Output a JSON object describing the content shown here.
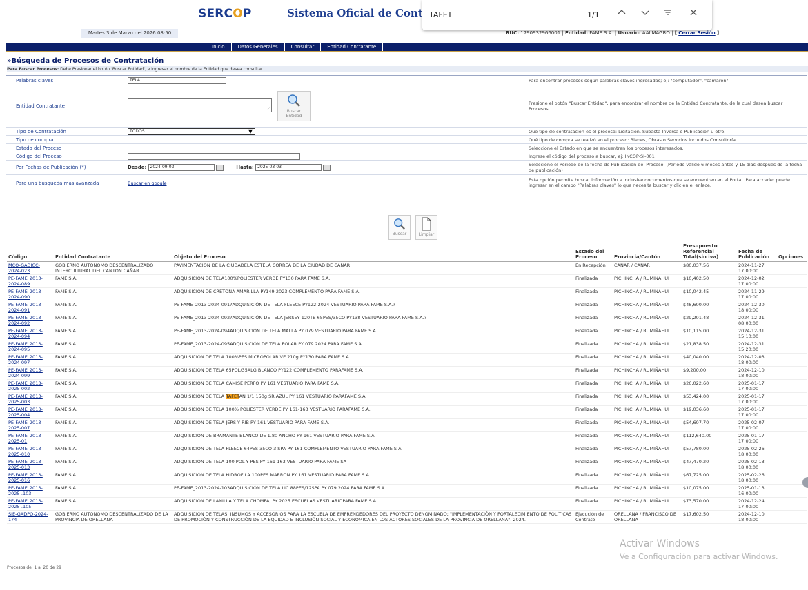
{
  "header": {
    "logo": {
      "part1": "SERC",
      "part2": "O",
      "part3": "P"
    },
    "site_title": "Sistema Oficial de Contrat",
    "date": "Martes 3 de Marzo del 2026 08:50",
    "ruc_label": "RUC:",
    "ruc_value": "1790932966001",
    "entity_label": "Entidad:",
    "entity_value": "FAME S.A.",
    "user_label": "Usuario:",
    "user_value": "AALMAGRO",
    "logout": "Cerrar Sesión"
  },
  "find_bar": {
    "query": "TAFET",
    "count": "1/1"
  },
  "nav": [
    "Inicio",
    "Datos Generales",
    "Consultar",
    "Entidad Contratante"
  ],
  "page": {
    "title": "»Búsqueda de Procesos de Contratación",
    "instr_bold": "Para Buscar Procesos:",
    "instr_text": " Debe Presionar el botón 'Buscar Entidad', e ingresar el nombre de la Entidad que desea consultar."
  },
  "form": {
    "keywords_label": "Palabras claves",
    "keywords_value": "TELA",
    "keywords_hint": "Para encontrar procesos según palabras claves ingresadas; ej: \"computador\", \"camarón\".",
    "entity_label": "Entidad Contratante",
    "entity_hint": "Presione el botón \"Buscar Entidad\", para encontrar el nombre de la Entidad Contratante, de la cual desea buscar Procesos.",
    "buscar_entidad_1": "Buscar",
    "buscar_entidad_2": "Entidad",
    "type_label": "Tipo de Contratación",
    "type_value": "TODOS",
    "type_hint": "Que tipo de contratación es el proceso: Licitación, Subasta Inversa o Publicación u otro.",
    "purchase_label": "Tipo de compra",
    "purchase_hint": "Qué tipo de compra se realizó en el proceso: Bienes, Obras o Servicios incluidos Consultoría",
    "state_label": "Estado del Proceso",
    "state_hint": "Seleccione el Estado en que se encuentren los procesos interesados.",
    "code_label": "Código del Proceso",
    "code_hint": "Ingrese el código del proceso a buscar, ej: INCOP-SI-001",
    "dates_label": "Por Fechas de Publicación (*)",
    "from_label": "Desde:",
    "from_value": "2024-09-03",
    "to_label": "Hasta:",
    "to_value": "2025-03-03",
    "dates_hint": "Seleccione el Periodo de la fecha de Publicación del Proceso. (Periodo válido 6 meses antes y 15 días después de la fecha de publicación)",
    "advanced_label": "Para una búsqueda más avanzada",
    "advanced_link": "Buscar en google",
    "advanced_hint": "Esta opción permite buscar información e inclusive documentos que se encuentren en el Portal. Para acceder puede ingresar en el campo \"Palabras claves\" lo que necesita buscar y clic en el enlace."
  },
  "buttons": {
    "search": "Buscar",
    "clear": "Limpiar"
  },
  "table": {
    "headers": [
      "Código",
      "Entidad Contratante",
      "Objeto del Proceso",
      "Estado del Proceso",
      "Provincia/Cantón",
      "Presupuesto Referencial Total(sin iva)",
      "Fecha de Publicación",
      "Opciones"
    ],
    "rows": [
      {
        "code": "MCO-GADICC-2024-023",
        "entity": "GOBIERNO AUTONOMO DESCENTRALIZADO INTERCULTURAL DEL CANTON CAÑAR",
        "object": "PAVIMENTACIÓN DE LA CIUDADELA ESTELA CORREA DE LA CIUDAD DE CAÑAR",
        "state": "En Recepción",
        "prov": "CAÑAR / CAÑAR",
        "budget": "$80,037.56",
        "date": "2024-11-27 17:00:00"
      },
      {
        "code": "PE-FAME_2013-2024-089",
        "entity": "FAME S.A.",
        "object": "ADQUISICIÓN DE TELA100%POLIESTER VERDE PY130 PARA FAME S.A.",
        "state": "Finalizada",
        "prov": "PICHINCHA / RUMIÑAHUI",
        "budget": "$10,402.50",
        "date": "2024-12-02 17:00:00"
      },
      {
        "code": "PE-FAME_2013-2024-090",
        "entity": "FAME S.A.",
        "object": "ADQUISICIÓN DE CRETONA AMARILLA PY149-2023 COMPLEMENTO PARA FAME S.A.",
        "state": "Finalizada",
        "prov": "PICHINCHA / RUMIÑAHUI",
        "budget": "$10,042.45",
        "date": "2024-11-29 17:00:00"
      },
      {
        "code": "PE-FAME_2013-2024-091",
        "entity": "FAME S.A.",
        "object": "PE-FAME_2013-2024-091?ADQUISICIÓN DE TELA FLEECE PY122-2024 VESTUARIO PARA FAME S.A.?",
        "state": "Finalizada",
        "prov": "PICHINCHA / RUMIÑAHUI",
        "budget": "$48,600.00",
        "date": "2024-12-30 18:00:00"
      },
      {
        "code": "PE-FAME_2013-2024-092",
        "entity": "FAME S.A.",
        "object": "PE-FAME_2013-2024-092?ADQUISICIÓN DE TELA JERSEY 120TB 65PES/35CO PY138 VESTUARIO PARA FAME S.A.?",
        "state": "Finalizada",
        "prov": "PICHINCHA / RUMIÑAHUI",
        "budget": "$29,201.48",
        "date": "2024-12-31 08:00:00"
      },
      {
        "code": "PE-FAME_2013-2024-094",
        "entity": "FAME S.A.",
        "object": "PE-FAME_2013-2024-094ADQUISICIÓN DE TELA MALLA PY 079 VESTUARIO PARA FAME S.A.",
        "state": "Finalizada",
        "prov": "PICHINCHA / RUMIÑAHUI",
        "budget": "$10,115.00",
        "date": "2024-12-31 15:10:00"
      },
      {
        "code": "PE-FAME_2013-2024-095",
        "entity": "FAME S.A.",
        "object": "PE-FAME_2013-2024-095ADQUISICIÓN DE TELA POLAR PY 079 2024 PARA FAME S.A.",
        "state": "Finalizada",
        "prov": "PICHINCHA / RUMIÑAHUI",
        "budget": "$21,838.50",
        "date": "2024-12-31 15:20:00"
      },
      {
        "code": "PE-FAME_2013-2024-097",
        "entity": "FAME S.A.",
        "object": "ADQUISICIÓN DE TELA 100%PES MICROPOLAR VE 210g PY130 PARA FAME S.A.",
        "state": "Finalizada",
        "prov": "PICHINCHA / RUMIÑAHUI",
        "budget": "$40,040.00",
        "date": "2024-12-03 18:00:00"
      },
      {
        "code": "PE-FAME_2013-2024-099",
        "entity": "FAME S.A.",
        "object": "ADQUISICIÓN DE TELA 65POL/35ALG BLANCO PY122 COMPLEMENTO PARAFAME S.A.",
        "state": "Finalizada",
        "prov": "PICHINCHA / RUMIÑAHUI",
        "budget": "$9,200.00",
        "date": "2024-12-10 18:00:00"
      },
      {
        "code": "PE-FAME_2013-2025-002",
        "entity": "FAME S.A.",
        "object": "ADQUISICIÓN DE TELA CAMISE PERFO PY 161 VESTUARIO PARA FAME S.A.",
        "state": "Finalizada",
        "prov": "PICHINCHA / RUMIÑAHUI",
        "budget": "$26,022.60",
        "date": "2025-01-17 17:00:00"
      },
      {
        "code": "PE-FAME_2013-2025-003",
        "entity": "FAME S.A.",
        "object_pre": "ADQUISICIÓN DE TELA ",
        "object_hl": "TAFET",
        "object_post": "AN 1/1 150g SR AZUL PY 161 VESTUARIO PARAFAME S.A.",
        "state": "Finalizada",
        "prov": "PICHINCHA / RUMIÑAHUI",
        "budget": "$53,424.00",
        "date": "2025-01-17 17:00:00"
      },
      {
        "code": "PE-FAME_2013-2025-004",
        "entity": "FAME S.A.",
        "object": "ADQUISICIÓN DE TELA 100% POLIESTER VERDE PY 161-163 VESTUARIO PARAFAME S.A.",
        "state": "Finalizada",
        "prov": "PICHINCHA / RUMIÑAHUI",
        "budget": "$19,036.60",
        "date": "2025-01-17 17:00:00"
      },
      {
        "code": "PE-FAME_2013-2025-007",
        "entity": "FAME S.A.",
        "object": "ADQUISICIÓN DE TELA JERS Y RIB PY 161 VESTUARIO PARA FAME S.A.",
        "state": "Finalizada",
        "prov": "PICHINCHA / RUMIÑAHUI",
        "budget": "$54,607.70",
        "date": "2025-02-07 17:00:00"
      },
      {
        "code": "PE-FAME_2013-2025-01",
        "entity": "FAME S.A.",
        "object": "ADQUISICIÓN DE BRAMANTE BLANCO DE 1.80 ANCHO PY 161 VESTUARIO PARA FAME S.A.",
        "state": "Finalizada",
        "prov": "PICHINCHA / RUMIÑAHUI",
        "budget": "$112,640.00",
        "date": "2025-01-17 17:00:00"
      },
      {
        "code": "PE-FAME_2013-2025-010",
        "entity": "FAME S.A.",
        "object": "ADQUISICIÓN DE TELA FLEECE 64PES 35CO 3 SPA PY 161 COMPLEMENTO VESTUARIO PARA FAME S A",
        "state": "Finalizada",
        "prov": "PICHINCHA / RUMIÑAHUI",
        "budget": "$57,780.00",
        "date": "2025-02-26 18:00:00"
      },
      {
        "code": "PE-FAME_2013-2025-013",
        "entity": "FAME S.A.",
        "object": "ADQUISICIÓN DE TELA 100 POL Y PES PY 161-163 VESTUARIO PARA FAME SA",
        "state": "Finalizada",
        "prov": "PICHINCHA / RUMIÑAHUI",
        "budget": "$47,470.20",
        "date": "2025-02-13 18:00:00"
      },
      {
        "code": "PE-FAME_2013-2025-016",
        "entity": "FAME S.A.",
        "object": "ADQUISICIÓN DE TELA HIDROFILA 100PES MARRON PY 161 VESTUARIO PARA FAME S.A.",
        "state": "Finalizada",
        "prov": "PICHINCHA / RUMIÑAHUI",
        "budget": "$67,725.00",
        "date": "2025-02-26 18:00:00"
      },
      {
        "code": "PE-FAME_2013-2025-.103",
        "entity": "FAME S.A.",
        "object": "PE-FAME_2013-2024-103ADQUISICIÓN DE TELA LIC 88PES/12SPA PY 079 2024 PARA FAME S.A.",
        "state": "Finalizada",
        "prov": "PICHINCHA / RUMIÑAHUI",
        "budget": "$10,075.00",
        "date": "2025-01-13 16:00:00"
      },
      {
        "code": "PE-FAME_2013-2025-.105",
        "entity": "FAME S.A.",
        "object": "ADQUISICIÓN DE LANILLA Y TELA CHOMPA, PY 2025 ESCUELAS VESTUARIOPARA FAME S.A.",
        "state": "Finalizada",
        "prov": "PICHINCHA / RUMIÑAHUI",
        "budget": "$73,570.00",
        "date": "2024-12-24 17:00:00"
      },
      {
        "code": "SIE-GADPO-2024-174",
        "entity": "GOBIERNO AUTONOMO DESCENTRALIZADO DE LA PROVINCIA DE ORELLANA",
        "object": "ADQUISICIÓN DE TELAS, INSUMOS Y ACCESORIOS PARA LA ESCUELA DE EMPRENDEDORES DEL PROYECTO DENOMINADO; \"IMPLEMENTACIÓN Y FORTALECIMIENTO DE POLÍTICAS DE PROMOCIÓN Y CONSTRUCCIÓN DE LA EQUIDAD E INCLUSIÓN SOCIAL Y ECONÓMICA EN LOS ACTORES SOCIALES DE LA PROVINCIA DE ORELLANA\". 2024.",
        "state": "Ejecución de Contrato",
        "prov": "ORELLANA / FRANCISCO DE ORELLANA",
        "budget": "$17,602.50",
        "date": "2024-12-10 18:00:00"
      }
    ]
  },
  "footer": {
    "count": "Procesos del 1 al 20 de 29"
  },
  "watermark": {
    "line1": "Activar Windows",
    "line2": "Ve a Configuración para activar Windows."
  }
}
